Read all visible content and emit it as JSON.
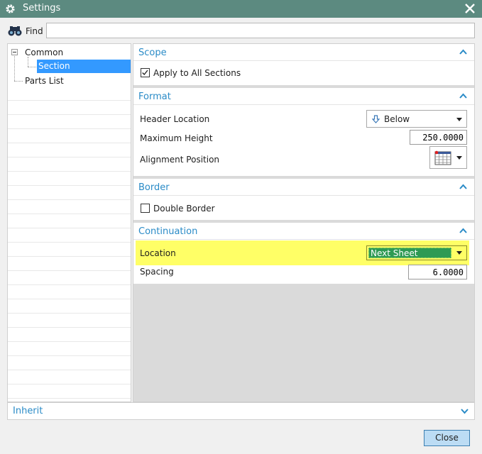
{
  "window": {
    "title": "Settings"
  },
  "find": {
    "label": "Find",
    "value": ""
  },
  "tree": {
    "items": [
      {
        "label": "Common",
        "expanded": true
      },
      {
        "label": "Section",
        "selected": true
      },
      {
        "label": "Parts List"
      }
    ]
  },
  "scope": {
    "title": "Scope",
    "apply_all_label": "Apply to All Sections",
    "apply_all_checked": true
  },
  "format": {
    "title": "Format",
    "header_location_label": "Header Location",
    "header_location_value": "Below",
    "max_height_label": "Maximum Height",
    "max_height_value": "250.0000",
    "alignment_label": "Alignment Position"
  },
  "border": {
    "title": "Border",
    "double_border_label": "Double Border",
    "double_border_checked": false
  },
  "continuation": {
    "title": "Continuation",
    "location_label": "Location",
    "location_value": "Next Sheet",
    "spacing_label": "Spacing",
    "spacing_value": "6.0000"
  },
  "inherit": {
    "title": "Inherit"
  },
  "footer": {
    "close_label": "Close"
  },
  "colors": {
    "titlebar": "#5c8a80",
    "section_header": "#2a8bc7",
    "highlight": "#ffff66",
    "location_fill": "#2e9a54",
    "selection": "#3399ff"
  },
  "icons": {
    "window": "gear-icon",
    "find": "binoculars-icon",
    "header_location": "down-arrow-icon",
    "alignment": "grid-position-icon",
    "collapse": "chevron-up-icon",
    "expand": "chevron-down-icon"
  }
}
